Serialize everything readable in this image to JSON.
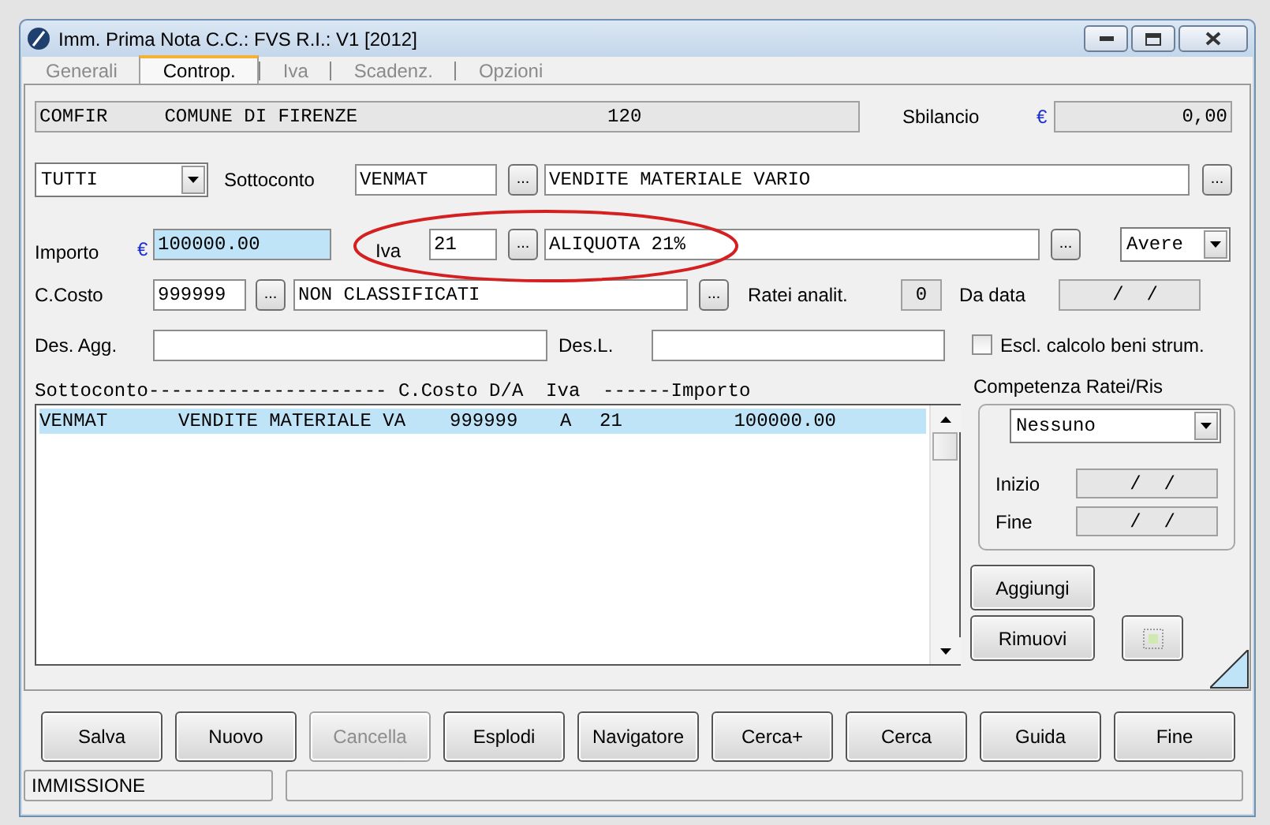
{
  "window": {
    "title": "Imm. Prima Nota C.C.: FVS  R.I.: V1  [2012]"
  },
  "tabs": [
    {
      "label": "Generali",
      "selected": false
    },
    {
      "label": "Controp.",
      "selected": true
    },
    {
      "label": "Iva",
      "selected": false
    },
    {
      "label": "Scadenz.",
      "selected": false
    },
    {
      "label": "Opzioni",
      "selected": false
    }
  ],
  "header": {
    "account": "COMFIR     COMUNE DI FIRENZE                      120",
    "sbilancio_label": "Sbilancio",
    "currency": "€",
    "sbilancio_value": "0,00"
  },
  "sottoconto_row": {
    "filter": "TUTTI",
    "label": "Sottoconto",
    "code": "VENMAT",
    "description": "VENDITE MATERIALE VARIO",
    "lookup_buttons": [
      "...",
      "..."
    ]
  },
  "importo_row": {
    "label": "Importo",
    "currency": "€",
    "value": "100000.00",
    "focused": true,
    "iva_label": "Iva",
    "iva_code": "21",
    "iva_description": "ALIQUOTA 21%",
    "lookup_buttons": [
      "...",
      "..."
    ],
    "side": "Avere"
  },
  "costo_row": {
    "label": "C.Costo",
    "code": "999999",
    "description": "NON CLASSIFICATI",
    "lookup_buttons": [
      "...",
      "..."
    ],
    "ratei_label": "Ratei analit.",
    "ratei_value": "0",
    "da_data_label": "Da data",
    "da_data_value": " /  /"
  },
  "des_row": {
    "des_agg_label": "Des. Agg.",
    "des_l_label": "Des.L.",
    "escl_label": "Escl. calcolo beni strum.",
    "escl_checked": false
  },
  "list": {
    "header": "Sottoconto--------------------- C.Costo D/A  Iva  ------Importo",
    "rows": [
      {
        "cells": [
          "VENMAT",
          "VENDITE MATERIALE VA",
          "999999",
          "A",
          "21",
          "100000.00"
        ],
        "selected": true
      }
    ]
  },
  "competenza": {
    "label": "Competenza Ratei/Ris",
    "value": "Nessuno",
    "inizio_label": "Inizio",
    "inizio_value": " /  /",
    "fine_label": "Fine",
    "fine_value": " /  /"
  },
  "side_buttons": [
    "Aggiungi",
    "Rimuovi"
  ],
  "buttons": [
    {
      "label": "Salva",
      "disabled": false
    },
    {
      "label": "Nuovo",
      "disabled": false
    },
    {
      "label": "Cancella",
      "disabled": true
    },
    {
      "label": "Esplodi",
      "disabled": false
    },
    {
      "label": "Navigatore",
      "disabled": false
    },
    {
      "label": "Cerca+",
      "disabled": false
    },
    {
      "label": "Cerca",
      "disabled": false
    },
    {
      "label": "Guida",
      "disabled": false
    },
    {
      "label": "Fine",
      "disabled": false
    }
  ],
  "status_bar": [
    "IMMISSIONE"
  ]
}
